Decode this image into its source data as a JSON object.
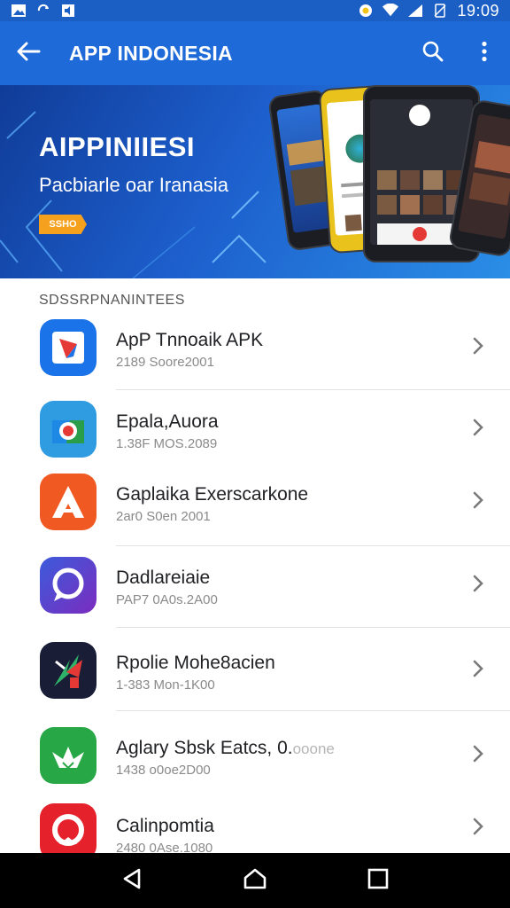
{
  "status_bar": {
    "time": "19:09",
    "left_icons": [
      "image-icon",
      "sync-icon",
      "sound-icon"
    ],
    "right_icons": [
      "settings-notification-icon",
      "wifi-icon",
      "signal-icon",
      "no-sim-icon"
    ]
  },
  "app_bar": {
    "title": "APP INDONESIA",
    "back_icon": "arrow-back-icon",
    "search_icon": "search-icon",
    "menu_icon": "more-vert-icon",
    "background": "#1e6ad8"
  },
  "banner": {
    "title": "AIPPINIIESI",
    "subtitle": "Pacbiarle oar Iranasia",
    "badge": "SSHO"
  },
  "section": {
    "header": "SDSSRPNANINTEES"
  },
  "apps": [
    {
      "name": "ApP Tnnoaik APK",
      "meta": "2189 Soore2001",
      "icon": "kite-app-icon",
      "color": "#1a73e8"
    },
    {
      "name": "Epala,Auora",
      "meta": "1.38F MOS.2089",
      "icon": "camera-app-icon",
      "color": "#2f9be0"
    },
    {
      "name": "Gaplaika Exerscarkone",
      "meta": "2ar0 S0en 2001",
      "icon": "a-logo-app-icon",
      "color": "#f05a22"
    },
    {
      "name": "Dadlareiaie",
      "meta": "PAP7 0A0s.2A00",
      "icon": "chat-bubble-app-icon",
      "color": "#5a3fd1"
    },
    {
      "name": "Rpolie Mohe8acien",
      "meta": "1-383 Mon-1K00",
      "icon": "bolt-app-icon",
      "color": "#1a1d36"
    },
    {
      "name": "Aglary Sbsk Eatcs, 0.",
      "name_faded": "ooone",
      "meta": "1438 o0oe2D00",
      "icon": "bird-app-icon",
      "color": "#27a745"
    },
    {
      "name": "Calinpomtia",
      "meta": "2480 0Ase.1080",
      "icon": "ring-app-icon",
      "color": "#e5222b"
    }
  ],
  "nav_bar": {
    "back": "nav-back-icon",
    "home": "nav-home-icon",
    "recents": "nav-recents-icon"
  }
}
